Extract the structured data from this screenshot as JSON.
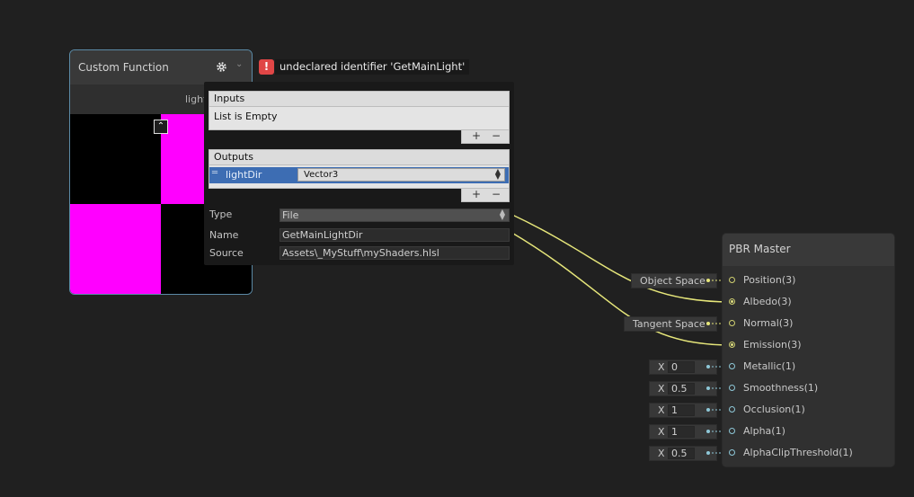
{
  "custom_function": {
    "title": "Custom Function",
    "gear_icon": "gear-icon",
    "chevron_icon": "chevron-down-icon",
    "port_label": "light",
    "preview_colors": [
      "#000000",
      "#ff00ff"
    ]
  },
  "error": {
    "icon": "!",
    "message": "undeclared identifier 'GetMainLight'"
  },
  "settings": {
    "inputs": {
      "header": "Inputs",
      "empty_text": "List is Empty",
      "add": "+",
      "remove": "−"
    },
    "outputs": {
      "header": "Outputs",
      "items": [
        {
          "name": "lightDir",
          "type": "Vector3"
        }
      ],
      "add": "+",
      "remove": "−"
    },
    "type": {
      "label": "Type",
      "value": "File"
    },
    "name": {
      "label": "Name",
      "value": "GetMainLightDir"
    },
    "source": {
      "label": "Source",
      "value": "Assets\\_MyStuff\\myShaders.hlsl"
    }
  },
  "pbr_master": {
    "title": "PBR Master",
    "slots": [
      {
        "label": "Position(3)",
        "default": "Object Space"
      },
      {
        "label": "Albedo(3)",
        "connected": true
      },
      {
        "label": "Normal(3)",
        "default": "Tangent Space"
      },
      {
        "label": "Emission(3)",
        "connected": true
      },
      {
        "label": "Metallic(1)",
        "x": "X",
        "value": "0"
      },
      {
        "label": "Smoothness(1)",
        "x": "X",
        "value": "0.5"
      },
      {
        "label": "Occlusion(1)",
        "x": "X",
        "value": "1"
      },
      {
        "label": "Alpha(1)",
        "x": "X",
        "value": "1"
      },
      {
        "label": "AlphaClipThreshold(1)",
        "x": "X",
        "value": "0.5"
      }
    ]
  },
  "colors": {
    "background": "#202020",
    "edge": "#e6e67a",
    "error": "#e04646",
    "selection": "#5b8aa6",
    "preview_magenta": "#ff00ff"
  }
}
